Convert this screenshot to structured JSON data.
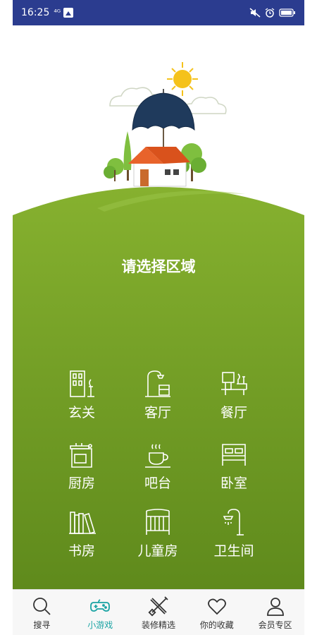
{
  "status_bar": {
    "time": "16:25",
    "left_icons": [
      "signal-text-icon",
      "image-icon"
    ],
    "right_icons": [
      "mute-icon",
      "alarm-icon",
      "battery-icon"
    ]
  },
  "main": {
    "title": "请选择区域",
    "regions": [
      {
        "label": "玄关",
        "icon": "entrance-icon"
      },
      {
        "label": "客厅",
        "icon": "living-room-lamp-icon"
      },
      {
        "label": "餐厅",
        "icon": "dining-icon"
      },
      {
        "label": "厨房",
        "icon": "kitchen-stove-icon"
      },
      {
        "label": "吧台",
        "icon": "coffee-cup-icon"
      },
      {
        "label": "卧室",
        "icon": "bed-icon"
      },
      {
        "label": "书房",
        "icon": "books-icon"
      },
      {
        "label": "儿童房",
        "icon": "crib-icon"
      },
      {
        "label": "卫生间",
        "icon": "shower-icon"
      }
    ]
  },
  "bottom_nav": {
    "items": [
      {
        "label": "搜寻",
        "icon": "search-icon"
      },
      {
        "label": "小游戏",
        "icon": "gamepad-icon",
        "active": true
      },
      {
        "label": "装修精选",
        "icon": "tools-icon"
      },
      {
        "label": "你的收藏",
        "icon": "heart-icon"
      },
      {
        "label": "会员专区",
        "icon": "user-icon"
      }
    ]
  },
  "colors": {
    "status_bar": "#2b3c8f",
    "green_light": "#85b02f",
    "green_dark": "#5f8a1c",
    "active_tab": "#1aa3a3"
  }
}
